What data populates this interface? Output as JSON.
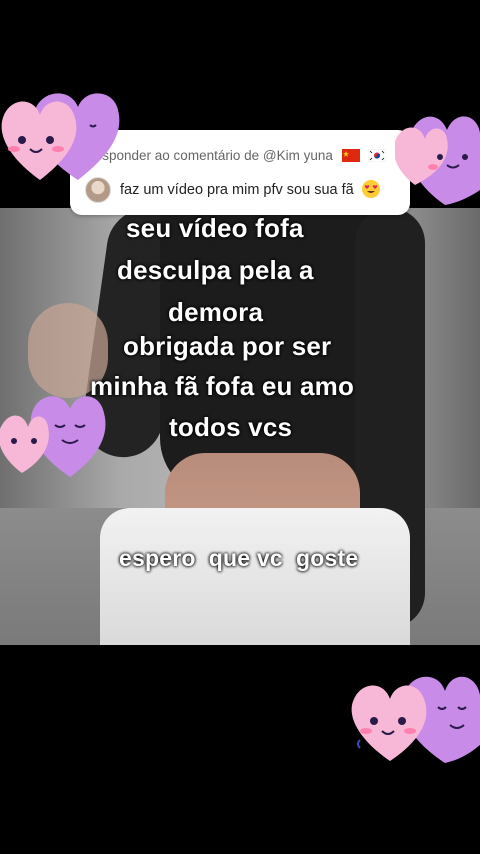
{
  "reply": {
    "header": "Responder ao comentário de @Kim yuna",
    "body": "faz um vídeo pra mim pfv sou sua fã",
    "emoji": "heart-eyes"
  },
  "captions": {
    "line1": "seu vídeo fofa",
    "line2": "desculpa pela a",
    "line3": "demora",
    "line4": "obrigada por ser",
    "line5": "minha fã fofa eu amo",
    "line6": "todos vcs",
    "line7": "espero  que vc  goste"
  },
  "colors": {
    "heart_pink": "#f7b8d8",
    "heart_purple": "#c98be8",
    "background": "#000000"
  }
}
